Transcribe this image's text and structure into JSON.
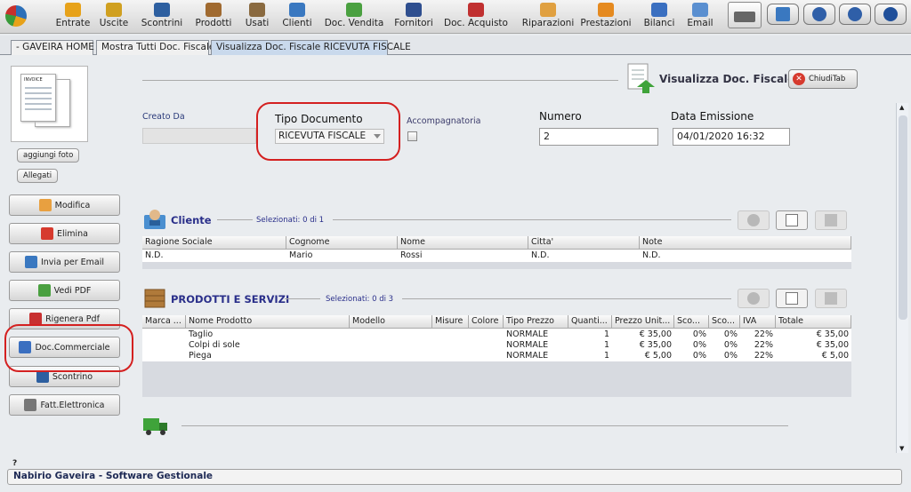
{
  "toolbar": {
    "items": [
      {
        "label": "Entrate",
        "color": "#e7a21a"
      },
      {
        "label": "Uscite",
        "color": "#d0a020"
      },
      {
        "label": "Scontrini",
        "color": "#2d5fa0"
      },
      {
        "label": "Prodotti",
        "color": "#a06a30"
      },
      {
        "label": "Usati",
        "color": "#8a6a40"
      },
      {
        "label": "Clienti",
        "color": "#3a78c0"
      },
      {
        "label": "Doc. Vendita",
        "color": "#4aa040"
      },
      {
        "label": "Fornitori",
        "color": "#2f4f8f"
      },
      {
        "label": "Doc. Acquisto",
        "color": "#c03030"
      },
      {
        "label": "Riparazioni",
        "color": "#e0a040"
      },
      {
        "label": "Prestazioni",
        "color": "#e58a20"
      },
      {
        "label": "Bilanci",
        "color": "#3a6fc0"
      },
      {
        "label": "Email",
        "color": "#5a8fd0"
      }
    ],
    "right_icons": [
      "keyboard-icon",
      "settings-icon",
      "minimize-icon",
      "power-icon"
    ]
  },
  "tabs": [
    {
      "label": " - GAVEIRA HOME - "
    },
    {
      "label": "Mostra Tutti Doc. Fiscale"
    },
    {
      "label": "Visualizza Doc. Fiscale RICEVUTA FISCALE"
    }
  ],
  "left": {
    "add_photo": "aggiungi foto",
    "attachments": "Allegati",
    "thumb_text": "INVOICE",
    "buttons": [
      {
        "label": "Modifica",
        "color": "#e8a040"
      },
      {
        "label": "Elimina",
        "color": "#d63a2e"
      },
      {
        "label": "Invia per Email",
        "color": "#3a78c0"
      },
      {
        "label": "Vedi PDF",
        "color": "#4aa040"
      },
      {
        "label": "Rigenera Pdf",
        "color": "#c83030"
      },
      {
        "label": "Doc.Commerciale",
        "color": "#3a6fc0"
      },
      {
        "label": "Scontrino",
        "color": "#2d5fa0"
      },
      {
        "label": "Fatt.Elettronica",
        "color": "#777777"
      }
    ]
  },
  "header": {
    "title": "Visualizza Doc. Fiscale",
    "close_label": "ChiudiTab"
  },
  "form": {
    "created_by_label": "Creato Da",
    "created_by_value": "",
    "doc_type_label": "Tipo Documento",
    "doc_type_value": "RICEVUTA FISCALE",
    "accompanying_label": "Accompagnatoria",
    "number_label": "Numero",
    "number_value": "2",
    "date_label": "Data Emissione",
    "date_value": "04/01/2020 16:32"
  },
  "client": {
    "title": "Cliente",
    "selected": "Selezionati:   0 di 1",
    "columns": [
      "Ragione Sociale",
      "Cognome",
      "Nome",
      "Citta'",
      "Note"
    ],
    "rows": [
      [
        "N.D.",
        "Mario",
        "Rossi",
        "N.D.",
        "N.D."
      ]
    ]
  },
  "products": {
    "title": "PRODOTTI E SERVIZI",
    "selected": "Selezionati:   0 di 3",
    "columns": [
      "Marca ...",
      "Nome Prodotto",
      "Modello",
      "Misure",
      "Colore",
      "Tipo Prezzo",
      "Quanti...",
      "Prezzo Unit...",
      "Sco...",
      "Sco...",
      "IVA",
      "Totale"
    ],
    "rows": [
      [
        "",
        "Taglio",
        "",
        "",
        "",
        "NORMALE",
        "1",
        "€ 35,00",
        "0%",
        "0%",
        "22%",
        "€ 35,00"
      ],
      [
        "",
        "Colpi di sole",
        "",
        "",
        "",
        "NORMALE",
        "1",
        "€ 35,00",
        "0%",
        "0%",
        "22%",
        "€ 35,00"
      ],
      [
        "",
        "Piega",
        "",
        "",
        "",
        "NORMALE",
        "1",
        "€ 5,00",
        "0%",
        "0%",
        "22%",
        "€ 5,00"
      ]
    ]
  },
  "statusbar": {
    "text": "Nabirio Gaveira - Software Gestionale",
    "question": "?"
  }
}
